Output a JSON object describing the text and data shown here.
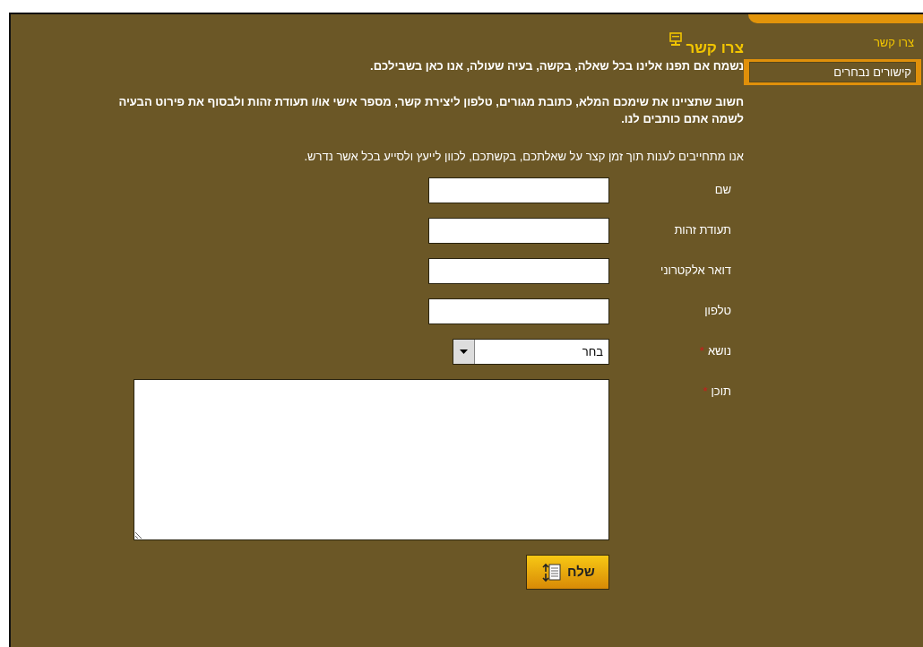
{
  "sidebar": {
    "items": [
      {
        "label": "צרו קשר",
        "selected": false
      },
      {
        "label": "קישורים נבחרים",
        "selected": true
      }
    ]
  },
  "content": {
    "title": "צרו קשר",
    "intro": "נשמח אם תפנו אלינו בכל שאלה, בקשה, בעיה שעולה, אנו כאן בשבילכם.",
    "note": "חשוב שתציינו את שימכם המלא, כתובת מגורים, טלפון ליצירת קשר, מספר אישי או/ו תעודת זהות ולבסוף את פירוט הבעיה לשמה אתם כותבים לנו.",
    "promise": "אנו מתחייבים לענות תוך זמן קצר על שאלתכם, בקשתכם, לכוון לייעץ ולסייע בכל אשר נדרש."
  },
  "form": {
    "fields": [
      {
        "label": "שם",
        "kind": "text",
        "required": false
      },
      {
        "label": "תעודת זהות",
        "kind": "text",
        "required": false
      },
      {
        "label": "דואר אלקטרוני",
        "kind": "text",
        "required": false
      },
      {
        "label": "טלפון",
        "kind": "text",
        "required": false
      },
      {
        "label": "נושא",
        "kind": "select",
        "required": true,
        "value": "בחר"
      },
      {
        "label": "תוכן",
        "kind": "textarea",
        "required": true
      }
    ],
    "required_mark": "*",
    "submit": "שלח"
  }
}
